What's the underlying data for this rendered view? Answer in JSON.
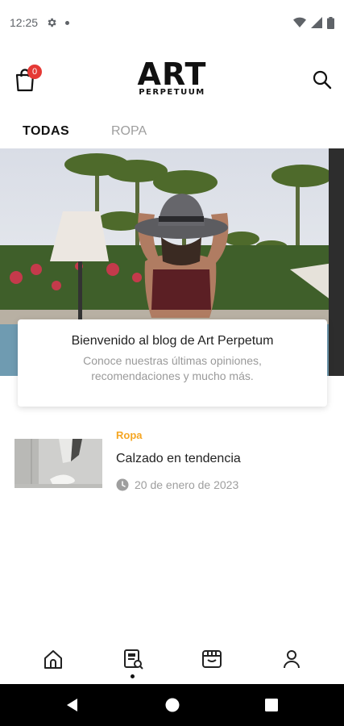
{
  "status_bar": {
    "time": "12:25",
    "icons": [
      "gear-icon",
      "notification-dot",
      "wifi-icon",
      "signal-icon",
      "battery-icon"
    ]
  },
  "header": {
    "cart_count": "0",
    "logo_main": "ART",
    "logo_sub": "PERPETUUM"
  },
  "tabs": [
    {
      "label": "TODAS",
      "active": true
    },
    {
      "label": "ROPA",
      "active": false
    }
  ],
  "welcome": {
    "title": "Bienvenido al blog de Art Perpetum",
    "subtitle": "Conoce nuestras últimas opiniones, recomendaciones y mucho más."
  },
  "articles": [
    {
      "category": "Ropa",
      "title": "Calzado en tendencia",
      "date": "20 de enero de 2023"
    }
  ],
  "bottom_nav": {
    "items": [
      "home-icon",
      "blog-icon",
      "store-icon",
      "profile-icon"
    ],
    "active_index": 1
  },
  "colors": {
    "accent": "#f5a623",
    "badge": "#e53935",
    "text_primary": "#1a1a1a",
    "text_muted": "#9e9e9e"
  }
}
